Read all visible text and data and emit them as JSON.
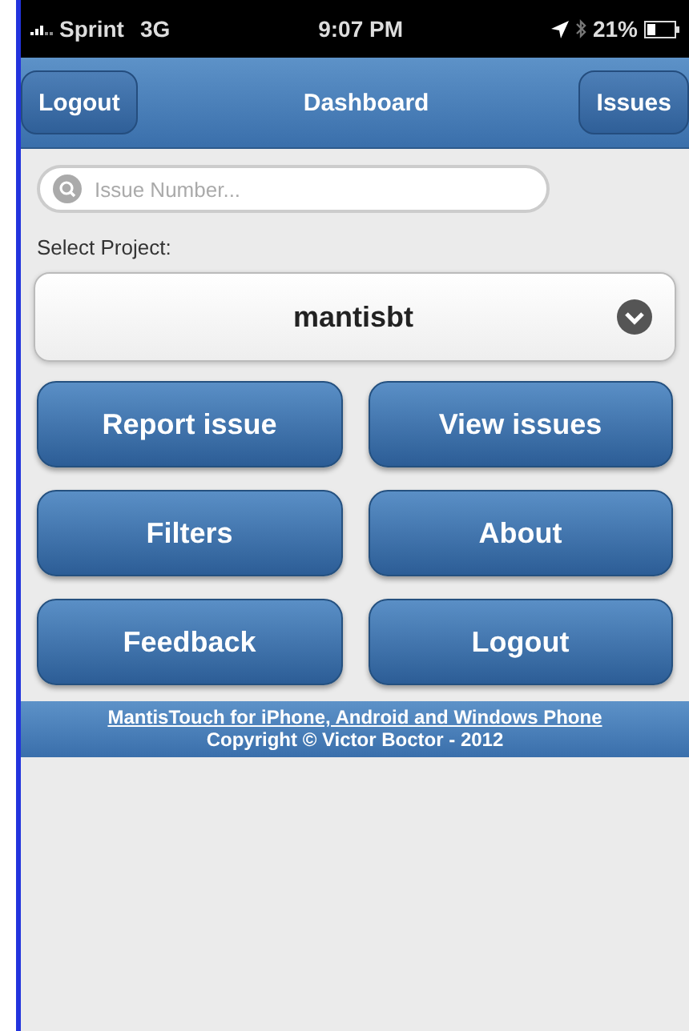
{
  "status_bar": {
    "carrier": "Sprint",
    "network": "3G",
    "time": "9:07 PM",
    "battery": "21%"
  },
  "header": {
    "left_button": "Logout",
    "title": "Dashboard",
    "right_button": "Issues"
  },
  "search": {
    "placeholder": "Issue Number..."
  },
  "project": {
    "label": "Select Project:",
    "value": "mantisbt"
  },
  "buttons": [
    "Report issue",
    "View issues",
    "Filters",
    "About",
    "Feedback",
    "Logout"
  ],
  "footer": {
    "link": "MantisTouch for iPhone, Android and Windows Phone",
    "copyright": "Copyright © Victor Boctor - 2012"
  }
}
